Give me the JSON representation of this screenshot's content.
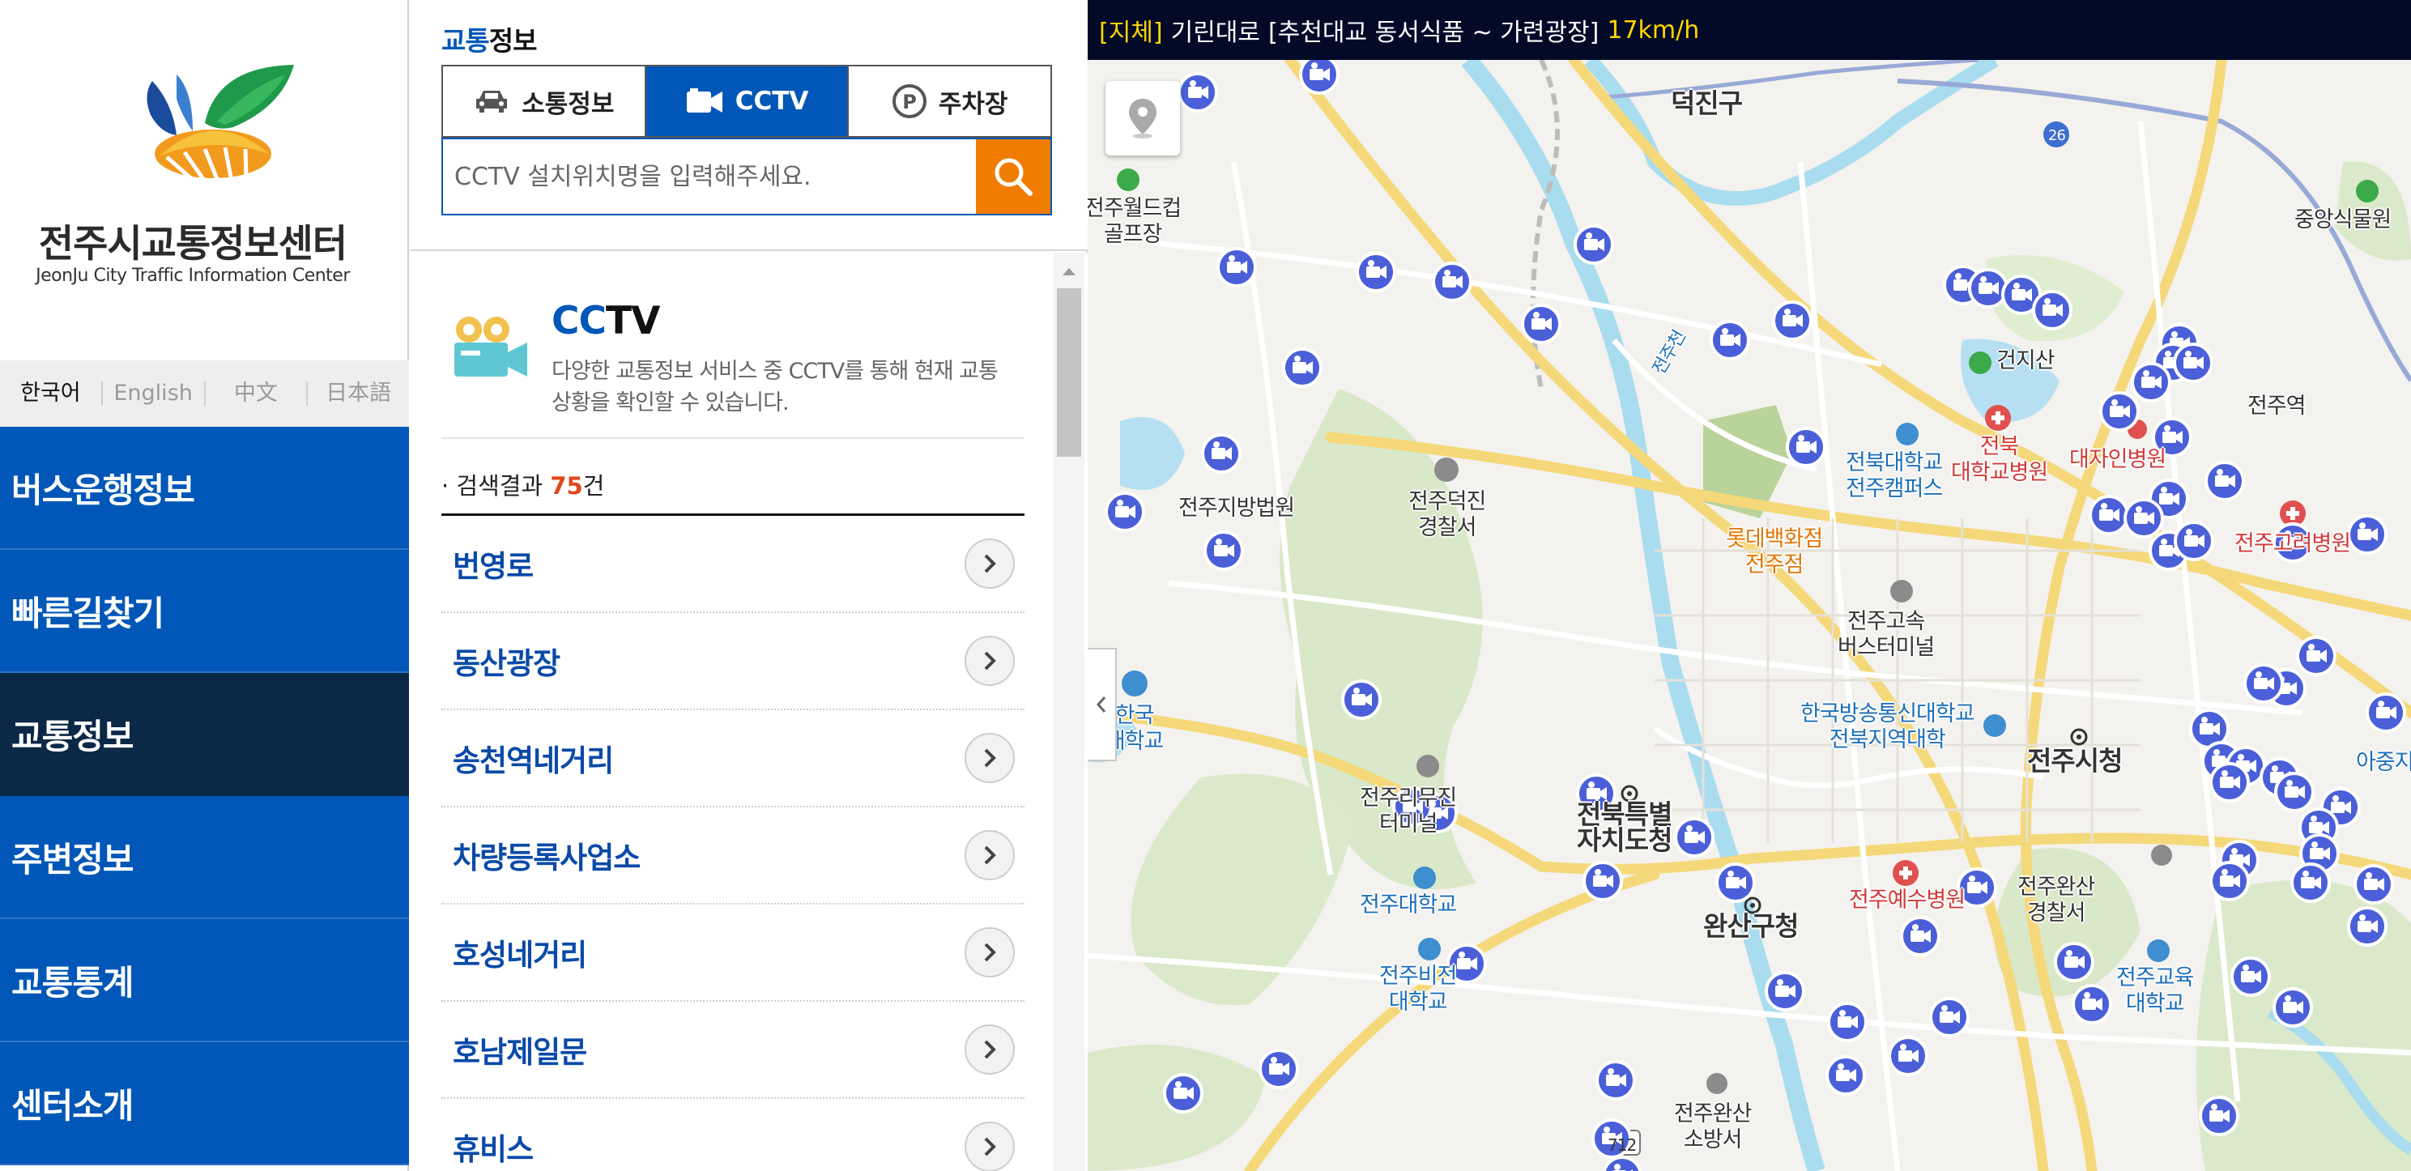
{
  "brand": {
    "title_ko": "전주시교통정보센터",
    "title_en": "JeonJu City Traffic Information Center"
  },
  "languages": [
    "한국어",
    "English",
    "中文",
    "日本語"
  ],
  "menu": [
    {
      "label": "버스운행정보"
    },
    {
      "label": "빠른길찾기"
    },
    {
      "label": "교통정보"
    },
    {
      "label": "주변정보"
    },
    {
      "label": "교통통계"
    },
    {
      "label": "센터소개"
    }
  ],
  "panel": {
    "title_accent": "교통",
    "title_rest": "정보",
    "tabs": [
      {
        "label": "소통정보",
        "icon": "car-icon"
      },
      {
        "label": "CCTV",
        "icon": "video-camera-icon"
      },
      {
        "label": "주차장",
        "icon": "parking-icon"
      }
    ],
    "search_placeholder": "CCTV 설치위치명을 입력해주세요.",
    "intro": {
      "title_accent": "CC",
      "title_rest": "TV",
      "desc": "다양한 교통정보 서비스 중 CCTV를 통해 현재 교통상황을 확인할 수 있습니다."
    },
    "result_prefix": "· 검색결과 ",
    "result_count": "75",
    "result_suffix": "건",
    "results": [
      {
        "name": "번영로"
      },
      {
        "name": "동산광장"
      },
      {
        "name": "송천역네거리"
      },
      {
        "name": "차량등록사업소"
      },
      {
        "name": "호성네거리"
      },
      {
        "name": "호남제일문"
      },
      {
        "name": "휴비스"
      }
    ]
  },
  "traffic_bar": {
    "status": "[지체]",
    "road": "기린대로",
    "segment": "[추천대교 동서식품 ~ 가련광장]",
    "speed": "17km/h"
  },
  "map": {
    "labels": [
      {
        "text": "덕진구",
        "style": "lbl-big"
      },
      {
        "text": "전주월드컵\n골프장",
        "style": "lbl-dark"
      },
      {
        "text": "중앙식물원",
        "style": "lbl-dark"
      },
      {
        "text": "건지산",
        "style": "lbl-dark"
      },
      {
        "text": "전주역",
        "style": "lbl-dark"
      },
      {
        "text": "전북\n대학교병원",
        "style": "lbl-red"
      },
      {
        "text": "대자인병원",
        "style": "lbl-red"
      },
      {
        "text": "전북대학교\n전주캠퍼스",
        "style": "lbl-blue"
      },
      {
        "text": "전주지방법원",
        "style": "lbl-dark"
      },
      {
        "text": "전주덕진\n경찰서",
        "style": "lbl-dark"
      },
      {
        "text": "롯데백화점\n전주점",
        "style": "lbl-orange"
      },
      {
        "text": "전주고려병원",
        "style": "lbl-red"
      },
      {
        "text": "전주고속\n버스터미널",
        "style": "lbl-dark"
      },
      {
        "text": "한국방송통신대학교\n전북지역대학",
        "style": "lbl-blue"
      },
      {
        "text": "립한국\n산대학교",
        "style": "lbl-blue"
      },
      {
        "text": "전주시청",
        "style": "lbl-big"
      },
      {
        "text": "아중지",
        "style": "lbl-blue"
      },
      {
        "text": "전주리무진\n터미널",
        "style": "lbl-dark"
      },
      {
        "text": "전북특별\n자치도청",
        "style": "lbl-big"
      },
      {
        "text": "전주대학교",
        "style": "lbl-blue"
      },
      {
        "text": "완산구청",
        "style": "lbl-big"
      },
      {
        "text": "전주예수병원",
        "style": "lbl-red"
      },
      {
        "text": "전주완산\n경찰서",
        "style": "lbl-dark"
      },
      {
        "text": "전주비전\n대학교",
        "style": "lbl-blue"
      },
      {
        "text": "전주교육\n대학교",
        "style": "lbl-blue"
      },
      {
        "text": "전주완산\n소방서",
        "style": "lbl-dark"
      },
      {
        "text": "전주천",
        "style": "lbl-blue"
      },
      {
        "text": "712",
        "style": "lbl-dark"
      },
      {
        "text": "26",
        "style": "lbl-dark"
      }
    ]
  },
  "colors": {
    "nav_blue": "#0057b7",
    "nav_active": "#0c2847",
    "search_orange": "#f07d00",
    "count_orange": "#e0461a",
    "cctv_marker": "#4a5fd8",
    "traffic_bar": "#020a28",
    "status_yellow": "#ffd500"
  }
}
